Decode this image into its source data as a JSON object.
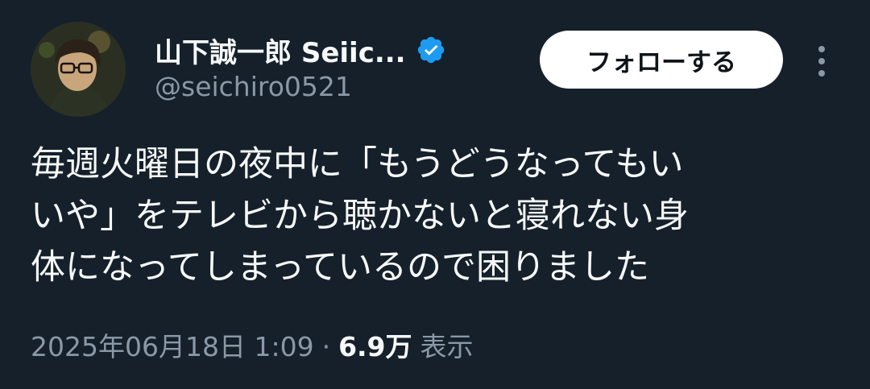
{
  "user": {
    "display_name": "山下誠一郎 Seiic...",
    "handle": "@seichiro0521",
    "verified": true
  },
  "actions": {
    "follow_label": "フォローする",
    "more_icon": "more-vertical-icon"
  },
  "tweet": {
    "text_lines": [
      "毎週火曜日の夜中に「もうどうなってもい",
      "いや」をテレビから聴かないと寝れない身",
      "体になってしまっているので困りました"
    ]
  },
  "meta": {
    "timestamp": "2025年06月18日 1:09",
    "separator": "·",
    "views_count": "6.9万",
    "views_label": "表示"
  },
  "colors": {
    "background": "#15202b",
    "text_primary": "#f7f9f9",
    "text_secondary": "#8b98a5",
    "verified_badge": "#1d9bf0",
    "follow_button_bg": "#ffffff"
  }
}
